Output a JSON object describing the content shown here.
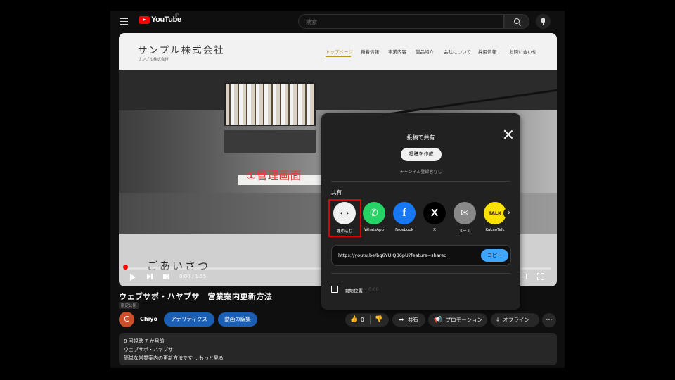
{
  "header": {
    "logo_text": "YouTube",
    "logo_super": "JP",
    "search_placeholder": "検索"
  },
  "video": {
    "site_company": "サンプル株式会社",
    "site_company_sub": "サンプル株式会社",
    "site_nav": [
      "トップページ",
      "新着情報",
      "事業内容",
      "製品紹介",
      "会社について",
      "採用情報",
      "お問い合わせ"
    ],
    "overlay_text": "①管理画面",
    "greeting": "ごあいさつ",
    "time": "0:00 / 1:55",
    "progress_fraction": 0.0
  },
  "title": "ウェブサポ・ハヤブサ　営業案内更新方法",
  "visibility": "限定公開",
  "channel": {
    "initial": "C",
    "name": "Chiyo",
    "analytics_label": "アナリティクス",
    "edit_label": "動画の編集"
  },
  "actions": {
    "like_count": "0",
    "share_label": "共有",
    "promotion_label": "プロモーション",
    "offline_label": "オフライン",
    "more_label": "…"
  },
  "description": {
    "stats": "8 回視聴  7 か月前",
    "line1": "ウェブサポ・ハヤブサ",
    "line2": "簡単な営業案内の更新方法です ...もっと見る"
  },
  "share_dialog": {
    "title": "投稿で共有",
    "post_button": "投稿を作成",
    "no_subscribers": "チャンネル登録者なし",
    "share_heading": "共有",
    "options": [
      {
        "label": "埋め込む",
        "glyph": "‹ ›",
        "color": "#f1f1f1",
        "fg": "#0f0f0f"
      },
      {
        "label": "WhatsApp",
        "glyph": "✆",
        "color": "#25d366",
        "fg": "#ffffff"
      },
      {
        "label": "Facebook",
        "glyph": "f",
        "color": "#1877f2",
        "fg": "#ffffff"
      },
      {
        "label": "X",
        "glyph": "X",
        "color": "#000000",
        "fg": "#ffffff"
      },
      {
        "label": "メール",
        "glyph": "✉",
        "color": "#888888",
        "fg": "#ffffff"
      },
      {
        "label": "KakaoTalk",
        "glyph": "TALK",
        "color": "#fae100",
        "fg": "#3c1e1e"
      }
    ],
    "next_arrow": "›",
    "url": "https://youtu.be/bq6YUiQB6pU?feature=shared",
    "copy_button": "コピー",
    "start_label": "開始位置",
    "start_time": "0:00"
  }
}
